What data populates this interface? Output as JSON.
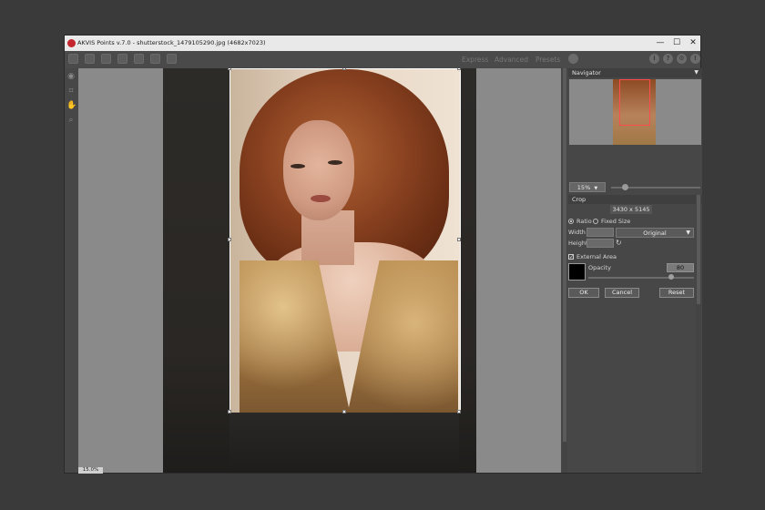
{
  "colors": {
    "background": "#3a3a3a",
    "crop_frame": "#ffffff",
    "nav_frame": "#ff4d4d"
  },
  "window": {
    "title": "AKVIS Points v.7.0 - shutterstock_1479105290.jpg (4682x7023)",
    "controls": {
      "minimize": "—",
      "maximize": "☐",
      "close": "✕"
    }
  },
  "toolbar": {
    "tabs": [
      "Express",
      "Advanced",
      "Presets"
    ],
    "icons": [
      "open-icon",
      "save-icon",
      "save-as-icon",
      "print-icon",
      "batch-icon",
      "share-icon",
      "plugin-icon"
    ],
    "right_icons": [
      "info-icon",
      "help-icon",
      "settings-icon",
      "news-icon"
    ]
  },
  "tools": [
    "eye-icon",
    "crop-icon",
    "hand-icon",
    "zoom-icon"
  ],
  "navigator": {
    "title": "Navigator"
  },
  "zoom": {
    "value": "15%",
    "status": "15.0%"
  },
  "crop": {
    "title": "Crop",
    "dimensions": "3430 x 5145",
    "ratio_label": "Ratio",
    "fixed_size_label": "Fixed Size",
    "width_label": "Width",
    "height_label": "Height",
    "ratio_option": "Original",
    "external_area_label": "External Area",
    "external_area_checked": true,
    "opacity_label": "Opacity",
    "opacity_value": "80",
    "buttons": {
      "ok": "OK",
      "cancel": "Cancel",
      "reset": "Reset"
    }
  }
}
